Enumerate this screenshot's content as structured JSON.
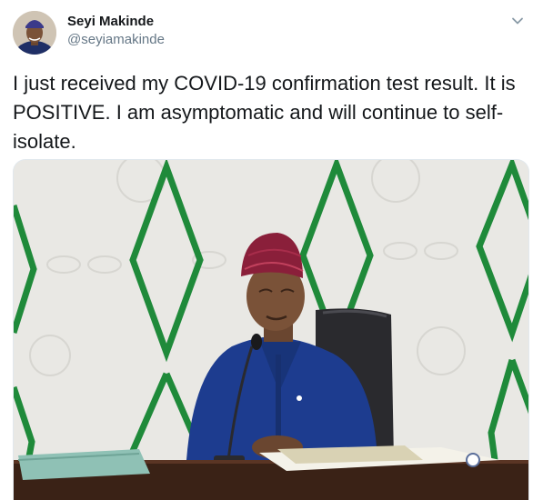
{
  "author": {
    "display_name": "Seyi Makinde",
    "handle": "@seyiamakinde"
  },
  "tweet": {
    "text": "I just received my COVID-19 confirmation test result. It is POSITIVE. I am asymptomatic and will continue to self-isolate."
  },
  "icons": {
    "menu": "chevron-down-icon"
  },
  "colors": {
    "text": "#14171a",
    "secondary": "#657786",
    "wall_green": "#1f8a3a",
    "agbada_blue": "#1d3c8f",
    "cap_color": "#8a1f3a"
  }
}
